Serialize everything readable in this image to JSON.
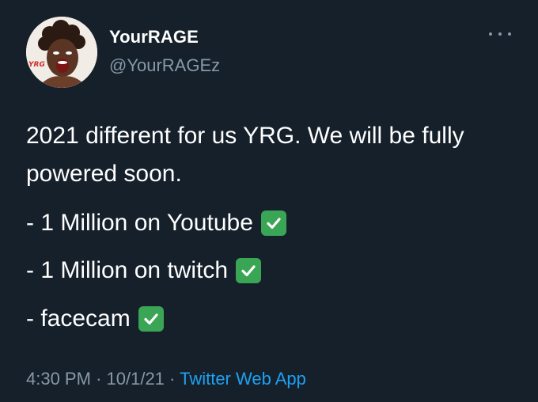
{
  "author": {
    "display_name": "YourRAGE",
    "handle": "@YourRAGEz",
    "avatar_badge": "YRG"
  },
  "tweet": {
    "intro": "2021 different for us YRG. We will be fully powered soon.",
    "items": [
      {
        "text": "- 1 Million on Youtube",
        "icon": "check-mark-button-icon"
      },
      {
        "text": "- 1 Million on twitch",
        "icon": "check-mark-button-icon"
      },
      {
        "text": "- facecam",
        "icon": "check-mark-button-icon"
      }
    ]
  },
  "meta": {
    "time": "4:30 PM",
    "separator": "·",
    "date": "10/1/21",
    "source": "Twitter Web App"
  },
  "colors": {
    "background": "#15202b",
    "primary_text": "#ffffff",
    "secondary_text": "#8899a6",
    "link": "#1da1f2",
    "check_green": "#3aa655"
  }
}
